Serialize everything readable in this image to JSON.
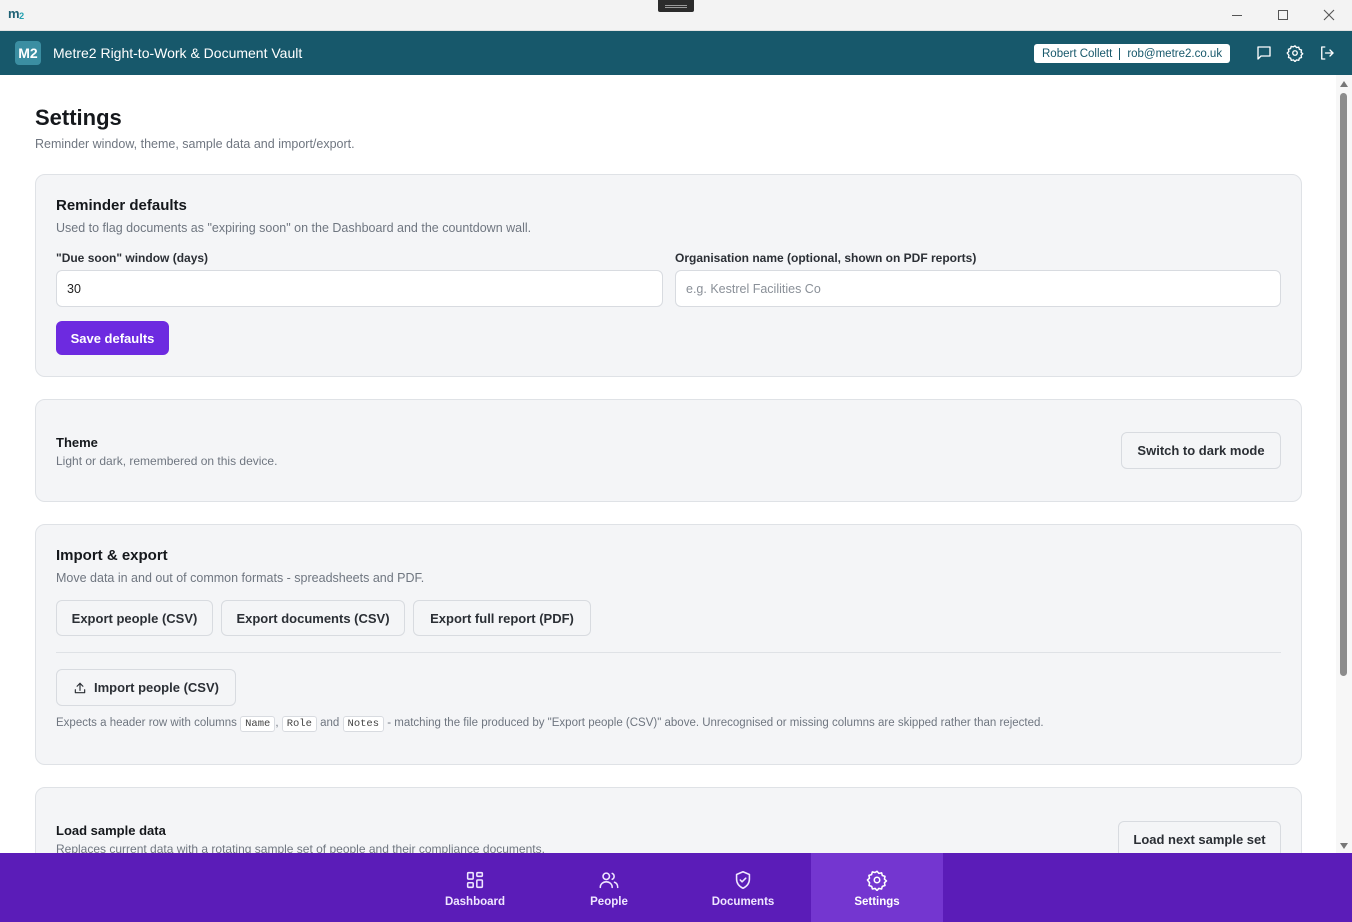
{
  "window": {
    "logo": "m",
    "logo_sub": "2"
  },
  "app": {
    "badge": "M2",
    "title": "Metre2 Right-to-Work & Document Vault",
    "user_name": "Robert Collett",
    "user_email": "rob@metre2.co.uk"
  },
  "page": {
    "title": "Settings",
    "subtitle": "Reminder window, theme, sample data and import/export."
  },
  "reminders": {
    "title": "Reminder defaults",
    "desc": "Used to flag documents as \"expiring soon\" on the Dashboard and the countdown wall.",
    "due_label": "\"Due soon\" window (days)",
    "due_value": "30",
    "org_label": "Organisation name (optional, shown on PDF reports)",
    "org_placeholder": "e.g. Kestrel Facilities Co",
    "save_label": "Save defaults"
  },
  "theme": {
    "title": "Theme",
    "desc": "Light or dark, remembered on this device.",
    "button": "Switch to dark mode"
  },
  "import_export": {
    "title": "Import & export",
    "desc": "Move data in and out of common formats - spreadsheets and PDF.",
    "export_people": "Export people (CSV)",
    "export_documents": "Export documents (CSV)",
    "export_report": "Export full report (PDF)",
    "import_people": "Import people (CSV)",
    "hint_pre": "Expects a header row with columns",
    "col_name": "Name",
    "col_role": "Role",
    "col_notes": "Notes",
    "hint_and": "and",
    "hint_post": "- matching the file produced by \"Export people (CSV)\" above. Unrecognised or missing columns are skipped rather than rejected."
  },
  "sample": {
    "title": "Load sample data",
    "desc": "Replaces current data with a rotating sample set of people and their compliance documents.",
    "button": "Load next sample set"
  },
  "nav": {
    "dashboard": "Dashboard",
    "people": "People",
    "documents": "Documents",
    "settings": "Settings",
    "active": "settings"
  },
  "colors": {
    "header": "#17586b",
    "accent": "#6d2ae0",
    "bottom_nav": "#5b1cb8"
  }
}
